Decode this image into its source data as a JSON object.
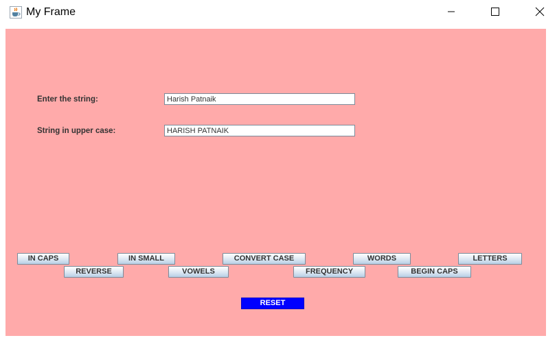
{
  "window": {
    "title": "My Frame",
    "icon": "java-cup-icon",
    "controls": [
      "minimize-icon",
      "maximize-icon",
      "close-icon"
    ]
  },
  "form": {
    "input_label": "Enter the string:",
    "input_value": "Harish Patnaik",
    "output_label": "String in upper case:",
    "output_value": "HARISH PATNAIK"
  },
  "buttons": {
    "in_caps": "IN CAPS",
    "reverse": "REVERSE",
    "in_small": "IN SMALL",
    "vowels": "VOWELS",
    "convert_case": "CONVERT CASE",
    "frequency": "FREQUENCY",
    "words": "WORDS",
    "begin_caps": "BEGIN CAPS",
    "letters": "LETTERS",
    "reset": "RESET"
  },
  "colors": {
    "panel_background": "#ffaaaa",
    "reset_button": "#0000ff",
    "reset_text": "#ffffff"
  }
}
